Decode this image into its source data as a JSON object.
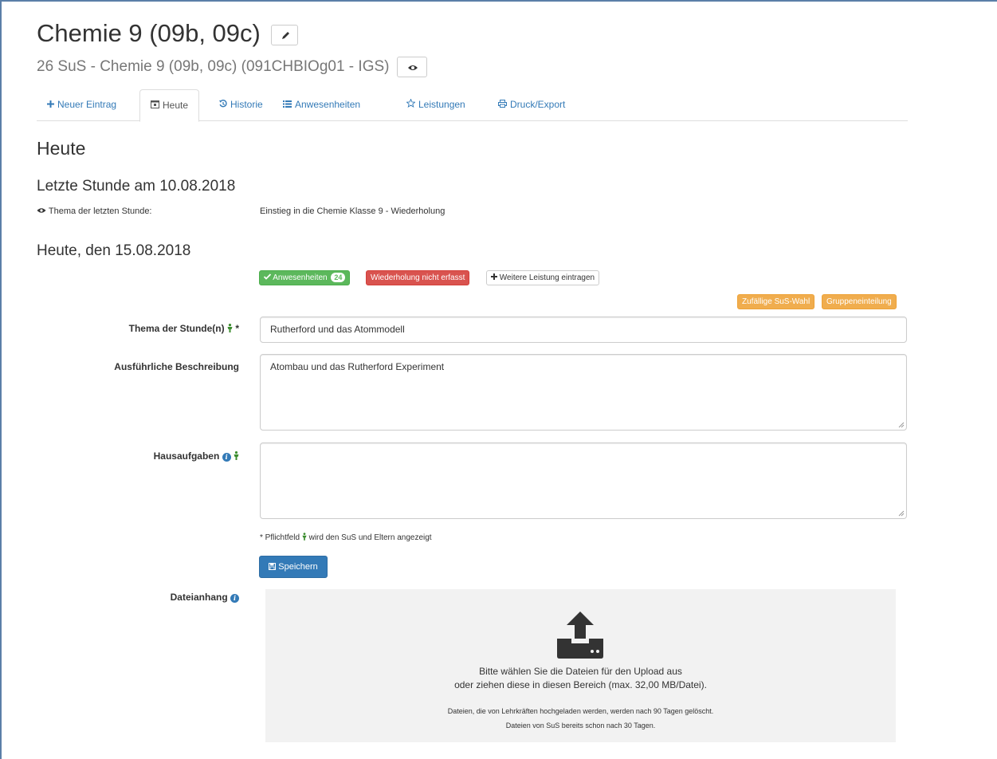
{
  "header": {
    "title": "Chemie 9 (09b, 09c)",
    "subtitle": "26 SuS - Chemie 9 (09b, 09c) (091CHBIOg01 - IGS)"
  },
  "tabs": [
    {
      "label": "Neuer Eintrag",
      "icon": "plus-icon"
    },
    {
      "label": "Heute",
      "icon": "calendar-icon"
    },
    {
      "label": "Historie",
      "icon": "history-icon"
    },
    {
      "label": "Anwesenheiten",
      "icon": "list-icon"
    },
    {
      "label": "Leistungen",
      "icon": "star-icon"
    },
    {
      "label": "Druck/Export",
      "icon": "print-icon"
    }
  ],
  "main": {
    "heading": "Heute",
    "last_lesson": {
      "heading": "Letzte Stunde am 10.08.2018",
      "topic_label": "Thema der letzten Stunde:",
      "topic_value": "Einstieg in die Chemie Klasse 9 - Wiederholung"
    },
    "today_heading": "Heute, den 15.08.2018",
    "buttons": {
      "attendance_label": "Anwesenheiten",
      "attendance_count": "24",
      "repetition_label": "Wiederholung nicht erfasst",
      "add_performance_label": "Weitere Leistung eintragen",
      "random_student_label": "Zufällige SuS-Wahl",
      "groups_label": "Gruppeneinteilung"
    },
    "form": {
      "topic_label": "Thema der Stunde(n)",
      "topic_value": "Rutherford und das Atommodell",
      "description_label": "Ausführliche Beschreibung",
      "description_value": "Atombau und das Rutherford Experiment",
      "homework_label": "Hausaufgaben",
      "homework_value": "",
      "required_marker": "*",
      "legend_required": "* Pflichtfeld",
      "legend_visible": "wird den SuS und Eltern angezeigt",
      "save_label": "Speichern"
    },
    "attachment": {
      "label": "Dateianhang",
      "line1": "Bitte wählen Sie die Dateien für den Upload aus",
      "line2": "oder ziehen diese in diesen Bereich (max. 32,00 MB/Datei).",
      "note1": "Dateien, die von Lehrkräften hochgeladen werden, werden nach 90 Tagen gelöscht.",
      "note2": "Dateien von SuS bereits schon nach 30 Tagen."
    }
  },
  "colors": {
    "link": "#337ab7",
    "success": "#5cb85c",
    "danger": "#d9534f",
    "warning": "#f0ad4e",
    "person_icon": "#3c8d2f"
  }
}
